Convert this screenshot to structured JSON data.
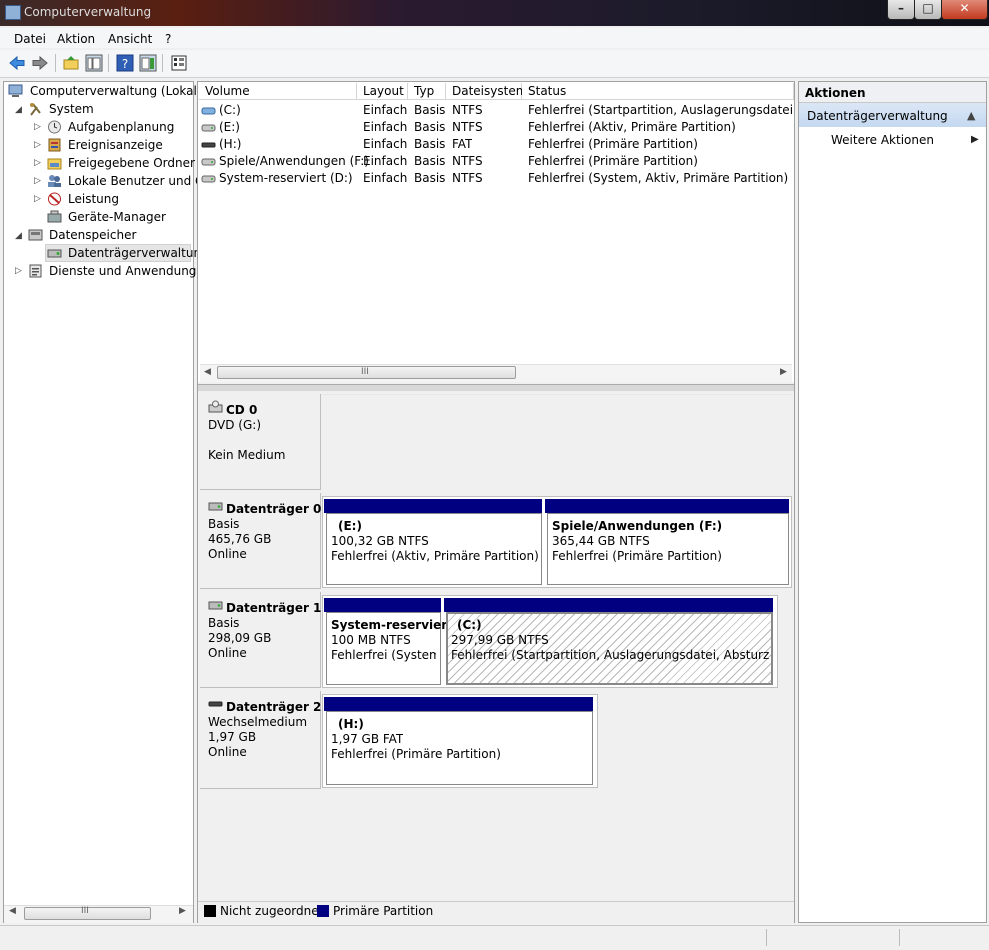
{
  "window": {
    "title": "Computerverwaltung"
  },
  "menu": [
    "Datei",
    "Aktion",
    "Ansicht",
    "?"
  ],
  "tree": {
    "root": "Computerverwaltung (Lokal)",
    "system": "System",
    "aufgabenplanung": "Aufgabenplanung",
    "ereignisanzeige": "Ereignisanzeige",
    "freigegebene": "Freigegebene Ordner",
    "lokale": "Lokale Benutzer und Gru",
    "leistung": "Leistung",
    "geraete": "Geräte-Manager",
    "datenspeicher": "Datenspeicher",
    "datentraeger": "Datenträgerverwaltung",
    "dienste": "Dienste und Anwendungen"
  },
  "volumes": {
    "columns": [
      "Volume",
      "Layout",
      "Typ",
      "Dateisystem",
      "Status"
    ],
    "rows": [
      [
        "(C:)",
        "Einfach",
        "Basis",
        "NTFS",
        "Fehlerfrei (Startpartition, Auslagerungsdatei, Abstu"
      ],
      [
        "(E:)",
        "Einfach",
        "Basis",
        "NTFS",
        "Fehlerfrei (Aktiv, Primäre Partition)"
      ],
      [
        "(H:)",
        "Einfach",
        "Basis",
        "FAT",
        "Fehlerfrei (Primäre Partition)"
      ],
      [
        "Spiele/Anwendungen (F:)",
        "Einfach",
        "Basis",
        "NTFS",
        "Fehlerfrei (Primäre Partition)"
      ],
      [
        "System-reserviert (D:)",
        "Einfach",
        "Basis",
        "NTFS",
        "Fehlerfrei (System, Aktiv, Primäre Partition)"
      ]
    ]
  },
  "scroll_grip": "III",
  "disks": {
    "cd0": {
      "name": "CD 0",
      "line1": "DVD (G:)",
      "line2": "Kein Medium"
    },
    "d0": {
      "name": "Datenträger 0",
      "line1": "Basis",
      "line2": "465,76 GB",
      "line3": "Online"
    },
    "d1": {
      "name": "Datenträger 1",
      "line1": "Basis",
      "line2": "298,09 GB",
      "line3": "Online"
    },
    "d2": {
      "name": "Datenträger 2",
      "line1": "Wechselmedium",
      "line2": "1,97 GB",
      "line3": "Online"
    }
  },
  "partitions": {
    "e": {
      "title": "(E:)",
      "size": "100,32 GB NTFS",
      "status": "Fehlerfrei (Aktiv, Primäre Partition)"
    },
    "f": {
      "title": "Spiele/Anwendungen  (F:)",
      "size": "365,44 GB NTFS",
      "status": "Fehlerfrei (Primäre Partition)"
    },
    "d": {
      "title": "System-reserviert",
      "size": "100 MB NTFS",
      "status": "Fehlerfrei (System, A"
    },
    "c": {
      "title": "(C:)",
      "size": "297,99 GB NTFS",
      "status": "Fehlerfrei (Startpartition, Auslagerungsdatei, Absturzabbild, I"
    },
    "h": {
      "title": "(H:)",
      "size": "1,97 GB FAT",
      "status": "Fehlerfrei (Primäre Partition)"
    }
  },
  "legend": {
    "unallocated": "Nicht zugeordnet",
    "primary": "Primäre Partition"
  },
  "actions": {
    "header": "Aktionen",
    "selected": "Datenträgerverwaltung",
    "more": "Weitere Aktionen"
  },
  "colors": {
    "primary_partition": "#000080",
    "unallocated": "#000000",
    "selection": "#c4d8f0"
  }
}
